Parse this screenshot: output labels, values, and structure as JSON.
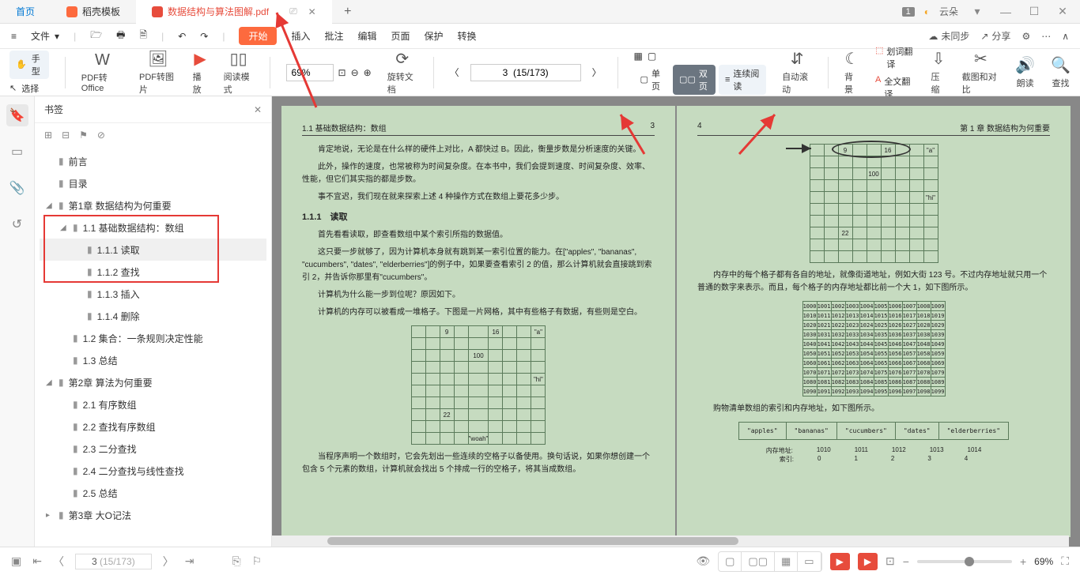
{
  "tabs": {
    "home": "首页",
    "shell": "稻壳模板",
    "doc": "数据结构与算法图解.pdf",
    "add": "+",
    "badge": "1",
    "cloud": "云朵"
  },
  "winbtns": {
    "min": "—",
    "max": "☐",
    "close": "✕",
    "menu": "▾"
  },
  "menubar": {
    "file": "文件",
    "arrow": "▾",
    "undo": "↶",
    "redo": "↷",
    "start": "开始",
    "insert": "插入",
    "comment": "批注",
    "edit": "编辑",
    "page": "页面",
    "protect": "保护",
    "convert": "转换",
    "unsync": "未同步",
    "share": "分享"
  },
  "toolbar": {
    "hand": "手型",
    "select": "选择",
    "pdf2office": "PDF转Office",
    "pdf2img": "PDF转图片",
    "play": "播放",
    "readmode": "阅读模式",
    "zoom": "69%",
    "fit": "⊡",
    "rotate": "旋转文档",
    "nav_prev": "〈",
    "nav_next": "〉",
    "pageinfo": "3  (15/173)",
    "single": "单页",
    "double": "双页",
    "cont": "连续阅读",
    "autoscroll": "自动滚动",
    "bg": "背景",
    "wordtrans": "划词翻译",
    "fulltrans": "全文翻译",
    "compress": "压缩",
    "crop": "截图和对比",
    "read": "朗读",
    "find": "查找"
  },
  "sidestrip": {
    "bookmark": "🔖",
    "thumb": "▭",
    "attach": "📎",
    "hist": "↺"
  },
  "bookmarks": {
    "title": "书签",
    "close": "✕",
    "t_expand": "⊞",
    "t_collapse": "⊟",
    "t_flag": "⚑",
    "t_del": "⊘",
    "items": [
      {
        "indent": 0,
        "tw": "",
        "label": "前言"
      },
      {
        "indent": 0,
        "tw": "",
        "label": "目录"
      },
      {
        "indent": 0,
        "tw": "◢",
        "label": "第1章   数据结构为何重要"
      },
      {
        "indent": 1,
        "tw": "◢",
        "label": "1.1   基础数据结构：数组"
      },
      {
        "indent": 2,
        "tw": "",
        "label": "1.1.1   读取",
        "sel": true
      },
      {
        "indent": 2,
        "tw": "",
        "label": "1.1.2   查找"
      },
      {
        "indent": 2,
        "tw": "",
        "label": "1.1.3   插入"
      },
      {
        "indent": 2,
        "tw": "",
        "label": "1.1.4   删除"
      },
      {
        "indent": 1,
        "tw": "",
        "label": "1.2   集合：一条规则决定性能"
      },
      {
        "indent": 1,
        "tw": "",
        "label": "1.3   总结"
      },
      {
        "indent": 0,
        "tw": "◢",
        "label": "第2章   算法为何重要"
      },
      {
        "indent": 1,
        "tw": "",
        "label": "2.1   有序数组"
      },
      {
        "indent": 1,
        "tw": "",
        "label": "2.2   查找有序数组"
      },
      {
        "indent": 1,
        "tw": "",
        "label": "2.3   二分查找"
      },
      {
        "indent": 1,
        "tw": "",
        "label": "2.4   二分查找与线性查找"
      },
      {
        "indent": 1,
        "tw": "",
        "label": "2.5   总结"
      },
      {
        "indent": 0,
        "tw": "▸",
        "label": "第3章   大O记法"
      }
    ]
  },
  "pageL": {
    "head_l": "1.1   基础数据结构：数组",
    "head_r": "3",
    "p1": "肯定地说，无论是在什么样的硬件上对比，A 都快过 B。因此，衡量步数是分析速度的关键。",
    "p2": "此外，操作的速度，也常被称为时间复杂度。在本书中，我们会提到速度、时间复杂度、效率、性能，但它们其实指的都是步数。",
    "p3": "事不宜迟，我们现在就来探索上述 4 种操作方式在数组上要花多少步。",
    "h1": "1.1.1　读取",
    "p4": "首先看看读取，即查看数组中某个索引所指的数据值。",
    "p5": "这只要一步就够了，因为计算机本身就有跳到某一索引位置的能力。在[\"apples\", \"bananas\", \"cucumbers\", \"dates\", \"elderberries\"]的例子中，如果要查看索引 2 的值，那么计算机就会直接跳到索引 2，并告诉你那里有\"cucumbers\"。",
    "p6": "计算机为什么能一步到位呢？原因如下。",
    "p7": "计算机的内存可以被看成一堆格子。下图是一片网格，其中有些格子有数据，有些则是空白。",
    "p8": "当程序声明一个数组时，它会先划出一些连续的空格子以备使用。换句话说，如果你想创建一个包含 5 个元素的数组，计算机就会找出 5 个排成一行的空格子，将其当成数组。",
    "badge": "1"
  },
  "pageR": {
    "head_l": "4",
    "head_r": "第 1 章   数据结构为何重要",
    "p1": "内存中的每个格子都有各自的地址，就像街道地址，例如大街 123 号。不过内存地址就只用一个普通的数字来表示。而且，每个格子的内存地址都比前一个大 1，如下图所示。",
    "p2": "购物清单数组的索引和内存地址，如下图所示。",
    "shop": [
      "\"apples\"",
      "\"bananas\"",
      "\"cucumbers\"",
      "\"dates\"",
      "\"elderberries\""
    ],
    "memlab": "内存地址:",
    "idxlab": "索引:",
    "memaddr": [
      "1010",
      "1011",
      "1012",
      "1013",
      "1014"
    ],
    "idx": [
      "0",
      "1",
      "2",
      "3",
      "4"
    ]
  },
  "statusbar": {
    "page": "3",
    "total": "(15/173)",
    "zoomval": "69%"
  },
  "chart_data": {
    "type": "table",
    "left_sparse_grid": {
      "rows": 10,
      "cols": 9,
      "cells": {
        "r0c2": "9",
        "r0c5": "16",
        "r0c8": "\"a\"",
        "r2c4": "100",
        "r4c8": "\"hi\"",
        "r7c2": "22",
        "r9c4": "\"woah\""
      }
    },
    "right_sparse_grid": {
      "rows": 10,
      "cols": 9,
      "cells": {
        "r0c2": "9",
        "r0c5": "16",
        "r0c8": "\"a\"",
        "r2c4": "100",
        "r4c8": "\"hi\"",
        "r7c2": "22"
      },
      "highlighted_row": 0,
      "highlighted_cols": [
        3,
        4,
        5,
        6,
        7
      ]
    },
    "memory_grid": {
      "rows": 10,
      "cols": 10,
      "start": 1000,
      "step": 1
    },
    "shopping_array": {
      "addresses": [
        1010,
        1011,
        1012,
        1013,
        1014
      ],
      "indices": [
        0,
        1,
        2,
        3,
        4
      ],
      "values": [
        "apples",
        "bananas",
        "cucumbers",
        "dates",
        "elderberries"
      ]
    }
  }
}
